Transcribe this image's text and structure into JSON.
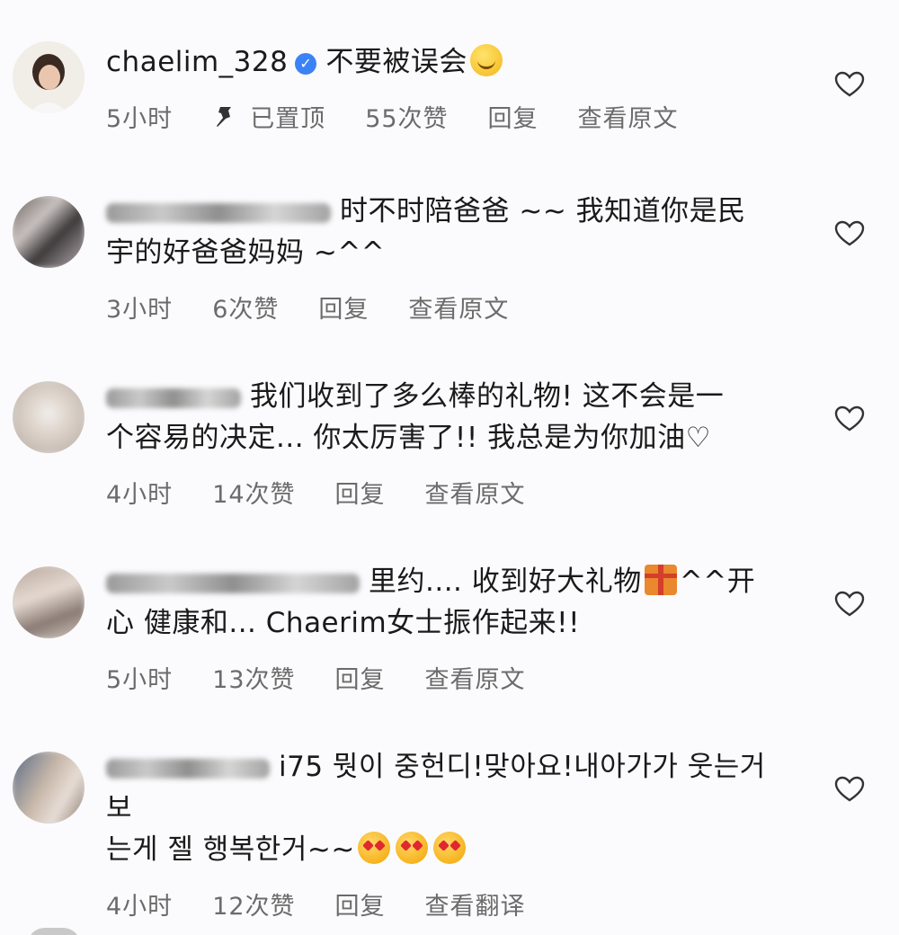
{
  "comments": [
    {
      "username": "chaelim_328",
      "verified": true,
      "text": "不要被误会",
      "time": "5小时",
      "pinned_label": "已置顶",
      "likes": "55次赞",
      "reply": "回复",
      "translate": "查看原文"
    },
    {
      "text_line1": "时不时陪爸爸 ~~ 我知道你是民",
      "text_line2": "宇的好爸爸妈妈 ~^^",
      "time": "3小时",
      "likes": "6次赞",
      "reply": "回复",
      "translate": "查看原文"
    },
    {
      "text_line1": "我们收到了多么棒的礼物! 这不会是一",
      "text_line2": "个容易的决定... 你太厉害了!! 我总是为你加油♡",
      "time": "4小时",
      "likes": "14次赞",
      "reply": "回复",
      "translate": "查看原文"
    },
    {
      "text_line1a": "里约.... 收到好大礼物",
      "text_line1b": "^^开",
      "text_line2": "心 健康和... Chaerim女士振作起来!!",
      "time": "5小时",
      "likes": "13次赞",
      "reply": "回复",
      "translate": "查看原文"
    },
    {
      "text_line1": "i75 뭣이 중헌디!맞아요!내아가가 웃는거 보",
      "text_line2": "는게 젤 행복한거~~",
      "time": "4小时",
      "likes": "12次赞",
      "reply": "回复",
      "translate": "查看翻译"
    }
  ],
  "icons": {
    "verified": "verified-badge-icon",
    "pin": "pin-icon",
    "like": "heart-outline-icon",
    "emoji_laugh": "laughing-emoji-icon",
    "emoji_love": "heart-eyes-emoji-icon",
    "gift": "gift-icon"
  },
  "colors": {
    "background": "#fbfbfd",
    "text": "#1a1a1a",
    "meta": "#6b6b6b",
    "verified": "#3b82f6"
  }
}
